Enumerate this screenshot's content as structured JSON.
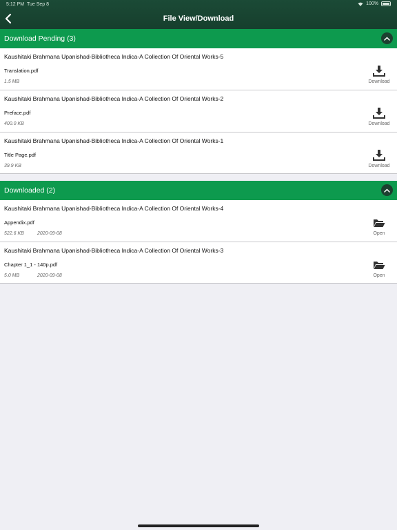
{
  "status": {
    "time": "5:12 PM",
    "date": "Tue Sep 8",
    "battery": "100%"
  },
  "nav": {
    "title": "File View/Download"
  },
  "pending": {
    "header": "Download Pending (3)",
    "items": [
      {
        "title": "Kaushitaki Brahmana Upanishad-Bibliotheca Indica-A Collection Of Oriental Works-5",
        "file": "Translation.pdf",
        "size": "1.5 MB",
        "action": "Download"
      },
      {
        "title": "Kaushitaki Brahmana Upanishad-Bibliotheca Indica-A Collection Of Oriental Works-2",
        "file": "Preface.pdf",
        "size": "400.0 KB",
        "action": "Download"
      },
      {
        "title": "Kaushitaki Brahmana Upanishad-Bibliotheca Indica-A Collection Of Oriental Works-1",
        "file": "Title Page.pdf",
        "size": "39.9 KB",
        "action": "Download"
      }
    ]
  },
  "downloaded": {
    "header": "Downloaded (2)",
    "items": [
      {
        "title": "Kaushitaki Brahmana Upanishad-Bibliotheca Indica-A Collection Of Oriental Works-4",
        "file": "Appendix.pdf",
        "size": "522.6 KB",
        "date": "2020-09-08",
        "action": "Open"
      },
      {
        "title": "Kaushitaki Brahmana Upanishad-Bibliotheca Indica-A Collection Of Oriental Works-3",
        "file": "Chapter 1_1 - 140p.pdf",
        "size": "5.0 MB",
        "date": "2020-09-08",
        "action": "Open"
      }
    ]
  },
  "colors": {
    "nav_bg": "#163f2d",
    "section_bg": "#0d9a4e",
    "page_bg": "#efeff4"
  },
  "icons": {
    "back": "chevron-left-icon",
    "collapse": "chevron-up-icon",
    "download": "download-icon",
    "open": "folder-open-icon"
  }
}
